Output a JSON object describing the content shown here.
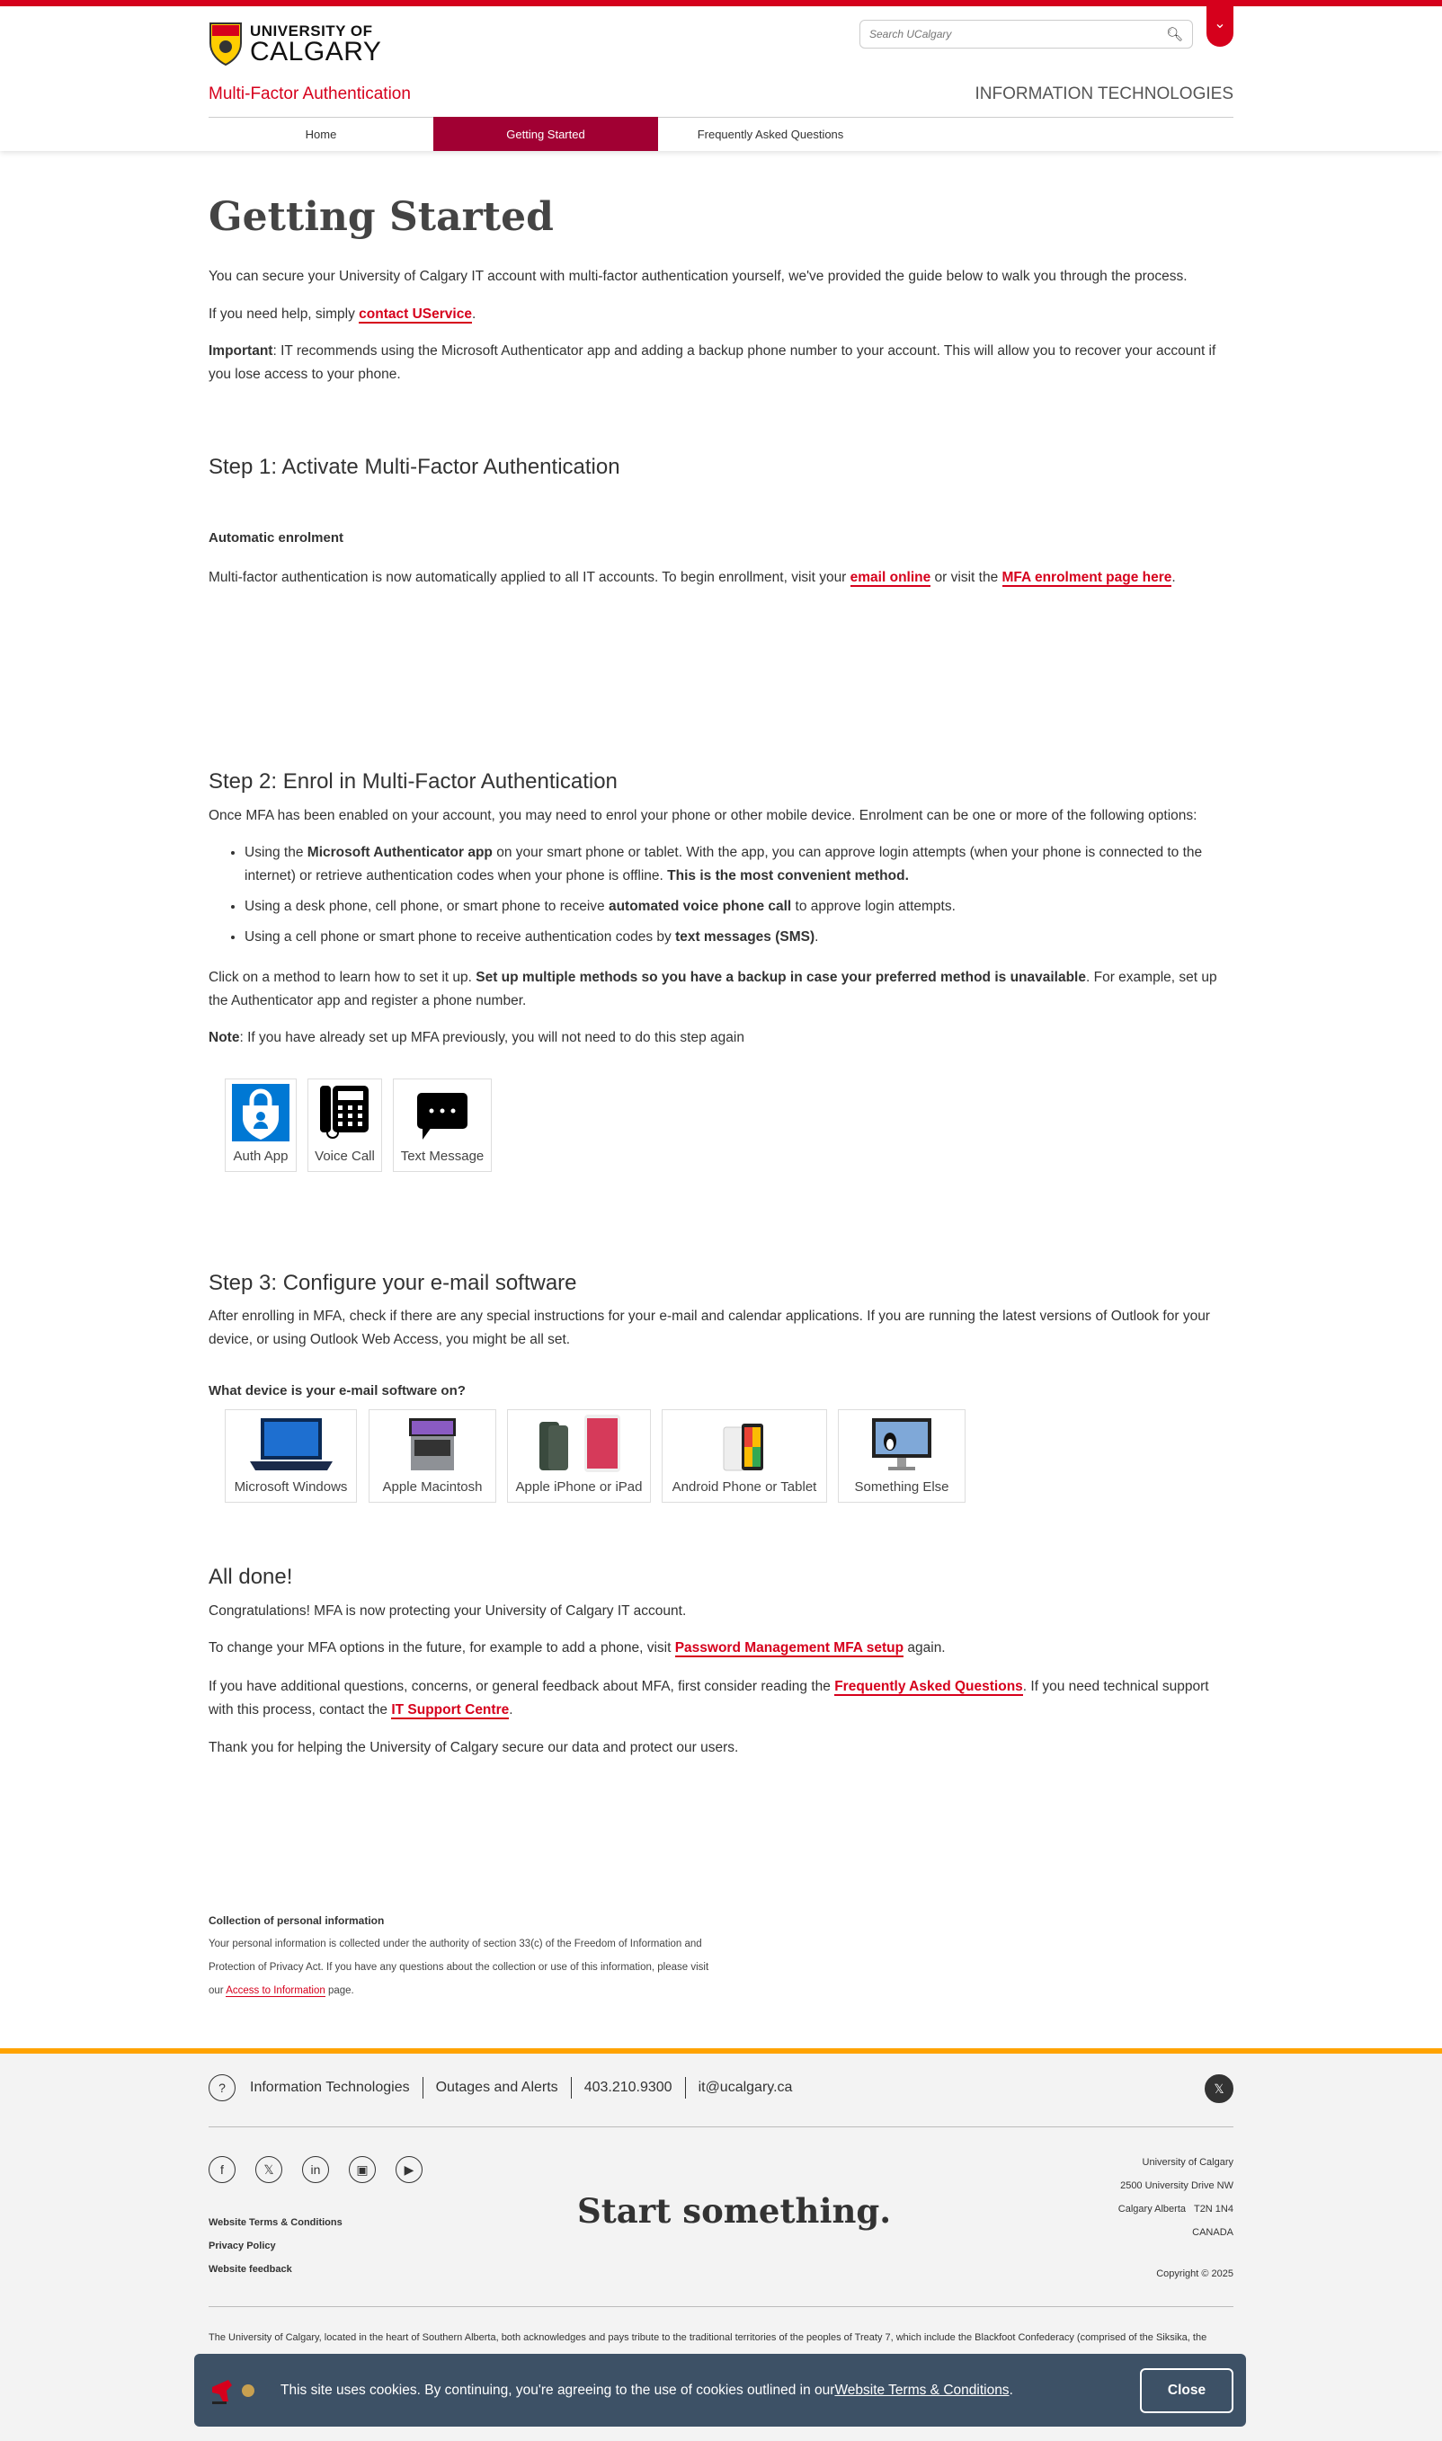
{
  "header": {
    "logo_line1": "UNIVERSITY OF",
    "logo_line2": "CALGARY",
    "search_placeholder": "Search UCalgary",
    "site_title": "Multi-Factor Authentication",
    "unit": "INFORMATION TECHNOLOGIES"
  },
  "nav": [
    {
      "label": "Home"
    },
    {
      "label": "Getting Started"
    },
    {
      "label": "Frequently Asked Questions"
    }
  ],
  "intro": {
    "title": "Getting Started",
    "p1": "You can secure your University of Calgary IT account with multi-factor authentication yourself, we've provided the guide below to walk you through the process.",
    "p2_pre": "If you need help, simply ",
    "p2_link": "contact UService",
    "p2_post": ".",
    "p3_bold": "Important",
    "p3": ": IT recommends using the Microsoft Authenticator app and adding a backup phone number to your account. This will allow you to recover your account if you lose access to your phone."
  },
  "step1": {
    "title": "Step 1: Activate Multi-Factor Authentication",
    "subhead": "Automatic enrolment",
    "p_pre": "Multi-factor authentication is now automatically applied to all IT accounts. To begin enrollment, visit your ",
    "link1": "email online",
    "p_mid": " or visit the ",
    "link2": "MFA enrolment page here",
    "p_post": "."
  },
  "step2": {
    "title": "Step 2: Enrol in Multi-Factor Authentication",
    "intro": "Once MFA has been enabled on your account, you may need to enrol your phone or other mobile device. Enrolment can be one or more of the following options:",
    "b1_pre": "Using the ",
    "b1_bold": "Microsoft Authenticator app",
    "b1_mid": " on your smart phone or tablet. With the app, you can approve login attempts (when your phone is connected to the internet) or retrieve authentication codes when your phone is offline. ",
    "b1_bold2": "This is the most convenient method.",
    "b2_pre": "Using a desk phone, cell phone, or smart phone to receive ",
    "b2_bold": "automated voice phone call",
    "b2_post": " to approve login attempts.",
    "b3_pre": "Using a cell phone or smart phone to receive authentication codes by ",
    "b3_bold": "text messages (SMS)",
    "b3_post": ".",
    "p2_pre": "Click on a method to learn how to set it up. ",
    "p2_bold": "Set up multiple methods so you have a backup in case your preferred method is unavailable",
    "p2_post": ". For example, set up the Authenticator app and register a phone number.",
    "note_bold": "Note",
    "note": ": If you have already set up MFA previously, you will not need to do this step again",
    "methods": [
      {
        "label": "Auth App"
      },
      {
        "label": "Voice Call"
      },
      {
        "label": "Text Message"
      }
    ]
  },
  "step3": {
    "title": "Step 3: Configure your e-mail software",
    "p": "After enrolling in MFA, check if there are any special instructions for your e-mail and calendar applications. If you are running the latest versions of Outlook for your device, or using Outlook Web Access, you might be all set.",
    "question": "What device is your e-mail software on?",
    "devices": [
      {
        "label": "Microsoft Windows"
      },
      {
        "label": "Apple Macintosh"
      },
      {
        "label": "Apple iPhone or iPad"
      },
      {
        "label": "Android Phone or Tablet"
      },
      {
        "label": "Something Else"
      }
    ]
  },
  "done": {
    "title": "All done!",
    "p1": "Congratulations! MFA is now protecting your University of Calgary IT account.",
    "p2_pre": "To change your MFA options in the future, for example to add a phone, visit ",
    "p2_link": "Password Management MFA setup",
    "p2_post": " again.",
    "p3_pre": "If you have additional questions, concerns, or general feedback about MFA, first consider reading the ",
    "p3_link": "Frequently Asked Questions",
    "p3_mid": ". If you need technical support with this process, contact the ",
    "p3_link2": "IT Support Centre",
    "p3_post": ".",
    "p4": "Thank you for helping the University of Calgary secure our data and protect our users."
  },
  "privacy": {
    "title": "Collection of personal information",
    "text": "Your personal information is collected under the authority of section 33(c) of the Freedom of Information and Protection of Privacy Act. If you have any questions about the collection or use of this information, please visit our ",
    "link": "Access to Information",
    "post": " page."
  },
  "footer": {
    "unit": "Information Technologies",
    "outages": "Outages and Alerts",
    "phone": "403.210.9300",
    "email": "it@ucalgary.ca",
    "tagline": "Start something.",
    "links": [
      "Website Terms & Conditions",
      "Privacy Policy",
      "Website feedback"
    ],
    "address": [
      "University of Calgary",
      "2500 University Drive NW",
      "Calgary Alberta   T2N 1N4",
      "CANADA"
    ],
    "copyright": "Copyright © 2025",
    "ack": "The University of Calgary, located in the heart of Southern Alberta, both acknowledges and pays tribute to the traditional territories of the peoples of Treaty 7, which include the Blackfoot Confederacy (comprised of the Siksika, the Piikani, and the Kainai First Nations), the Tsuut'ina First Nation, and the Stoney Nakoda (including Chiniki, Bearspaw, and Goodstoney First Nations). The City of Calgary is also home to the Métis Nation of"
  },
  "cookie": {
    "text": "This site uses cookies. By continuing, you're agreeing to the use of cookies outlined in our ",
    "link": "Website Terms & Conditions",
    "post": ".",
    "close": "Close"
  },
  "colors": {
    "brand_red": "#d6001c",
    "nav_active": "#a10033",
    "footer_accent": "#ffa300",
    "cookie_bg": "#3d5166"
  }
}
